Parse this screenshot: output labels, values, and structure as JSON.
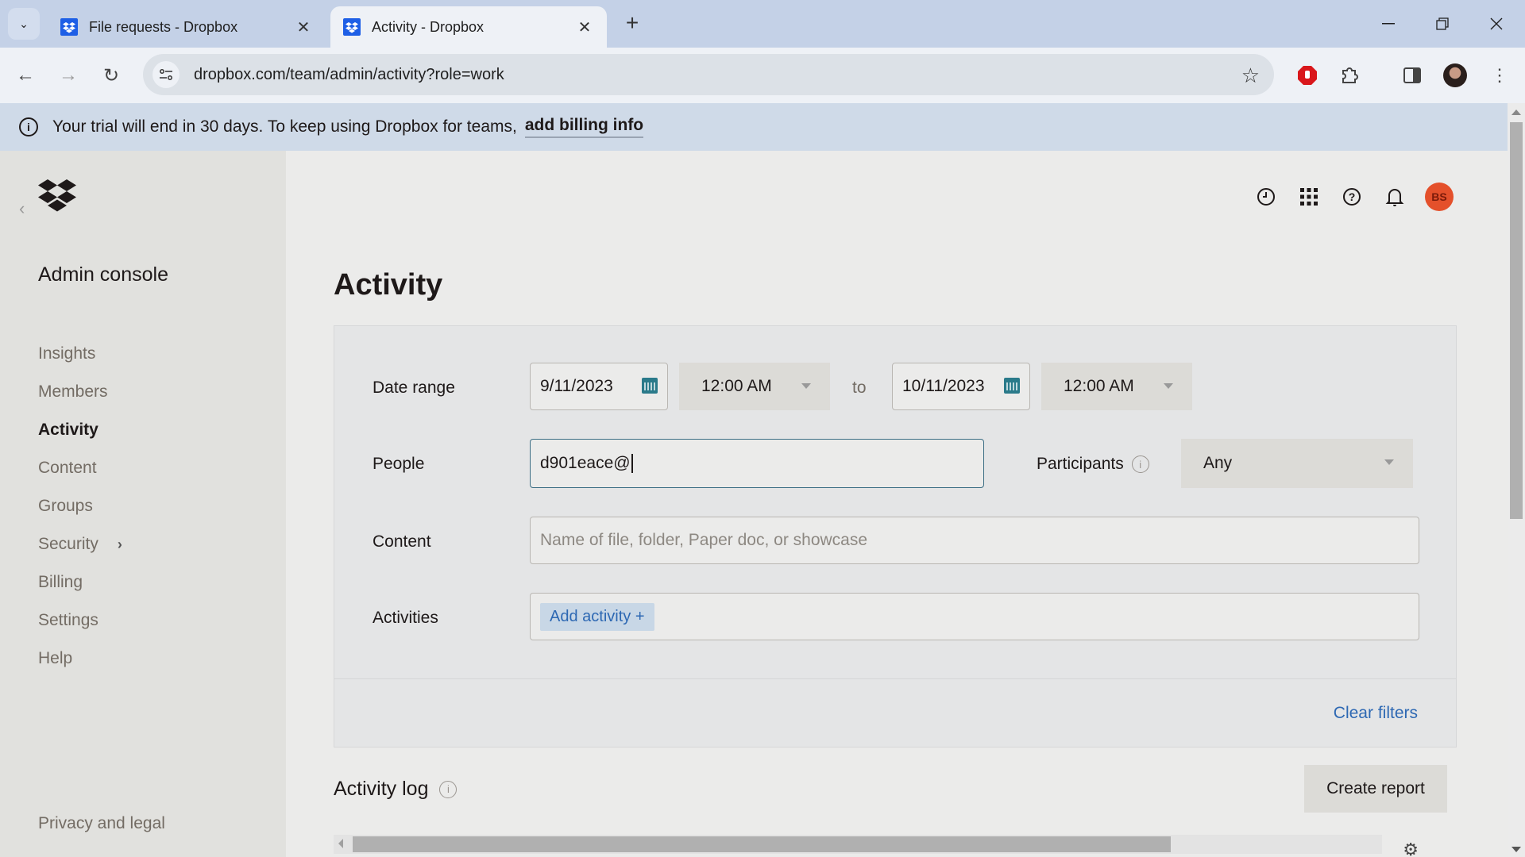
{
  "browser": {
    "tabs": [
      {
        "title": "File requests - Dropbox",
        "active": false
      },
      {
        "title": "Activity - Dropbox",
        "active": true
      }
    ],
    "url": "dropbox.com/team/admin/activity?role=work"
  },
  "banner": {
    "text": "Your trial will end in 30 days. To keep using Dropbox for teams,",
    "link": "add billing info"
  },
  "sidebar": {
    "title": "Admin console",
    "items": [
      {
        "label": "Insights",
        "active": false
      },
      {
        "label": "Members",
        "active": false
      },
      {
        "label": "Activity",
        "active": true
      },
      {
        "label": "Content",
        "active": false
      },
      {
        "label": "Groups",
        "active": false
      },
      {
        "label": "Security",
        "active": false,
        "has_submenu": true
      },
      {
        "label": "Billing",
        "active": false
      },
      {
        "label": "Settings",
        "active": false
      },
      {
        "label": "Help",
        "active": false
      }
    ],
    "footer_link": "Privacy and legal"
  },
  "header": {
    "icons": [
      "activity-clock-icon",
      "app-grid-icon",
      "help-icon",
      "notifications-bell-icon"
    ],
    "avatar_initials": "BS",
    "avatar_color": "#e4502b"
  },
  "main": {
    "title": "Activity",
    "filters": {
      "date_range_label": "Date range",
      "start_date": "9/11/2023",
      "start_time": "12:00 AM",
      "to_label": "to",
      "end_date": "10/11/2023",
      "end_time": "12:00 AM",
      "people_label": "People",
      "people_value": "d901eace@",
      "participants_label": "Participants",
      "participants_value": "Any",
      "content_label": "Content",
      "content_placeholder": "Name of file, folder, Paper doc, or showcase",
      "activities_label": "Activities",
      "add_activity": "Add activity +",
      "clear_filters": "Clear filters"
    },
    "activity_log": {
      "title": "Activity log",
      "create_report": "Create report"
    }
  },
  "colors": {
    "link": "#2d68b3",
    "brand": "#1e5fe6"
  }
}
